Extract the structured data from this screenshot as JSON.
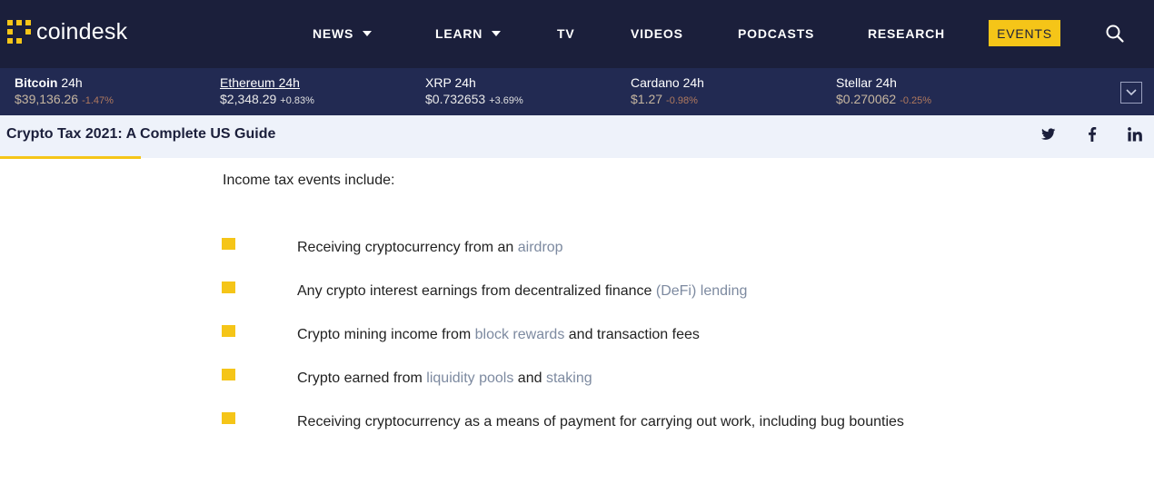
{
  "brand": {
    "logo_text": "coindesk",
    "accent_color": "#f5c518",
    "nav_bg": "#1b1f3b",
    "ticker_bg": "#222a52"
  },
  "nav": {
    "items": [
      {
        "label": "NEWS",
        "has_dropdown": true
      },
      {
        "label": "LEARN",
        "has_dropdown": true
      },
      {
        "label": "TV",
        "has_dropdown": false
      },
      {
        "label": "VIDEOS",
        "has_dropdown": false
      },
      {
        "label": "PODCASTS",
        "has_dropdown": false
      },
      {
        "label": "RESEARCH",
        "has_dropdown": false
      }
    ],
    "events_label": "EVENTS",
    "search_icon": "search-icon"
  },
  "ticker": [
    {
      "name": "Bitcoin",
      "period": "24h",
      "price": "$39,136.26",
      "change": "-1.47%"
    },
    {
      "name": "Ethereum",
      "period": "24h",
      "price": "$2,348.29",
      "change": "+0.83%"
    },
    {
      "name": "XRP",
      "period": "24h",
      "price": "$0.732653",
      "change": "+3.69%"
    },
    {
      "name": "Cardano",
      "period": "24h",
      "price": "$1.27",
      "change": "-0.98%"
    },
    {
      "name": "Stellar",
      "period": "24h",
      "price": "$0.270062",
      "change": "-0.25%"
    }
  ],
  "article": {
    "title": "Crypto Tax 2021: A Complete US Guide",
    "share_icons": [
      "twitter-icon",
      "facebook-icon",
      "linkedin-icon"
    ],
    "intro": "Income tax events include:",
    "bullets": [
      {
        "before": "Receiving cryptocurrency from an ",
        "link": "airdrop",
        "after": ""
      },
      {
        "before": "Any crypto interest earnings from decentralized finance ",
        "link": "(DeFi) lending",
        "after": ""
      },
      {
        "before": "Crypto mining income from ",
        "link": "block rewards",
        "after": " and transaction fees"
      },
      {
        "before": "Crypto earned from ",
        "link": "liquidity pools",
        "middle": " and ",
        "link2": "staking",
        "after": ""
      },
      {
        "before": "Receiving cryptocurrency as a means of payment for carrying out work, including bug bounties",
        "link": "",
        "after": ""
      }
    ]
  }
}
